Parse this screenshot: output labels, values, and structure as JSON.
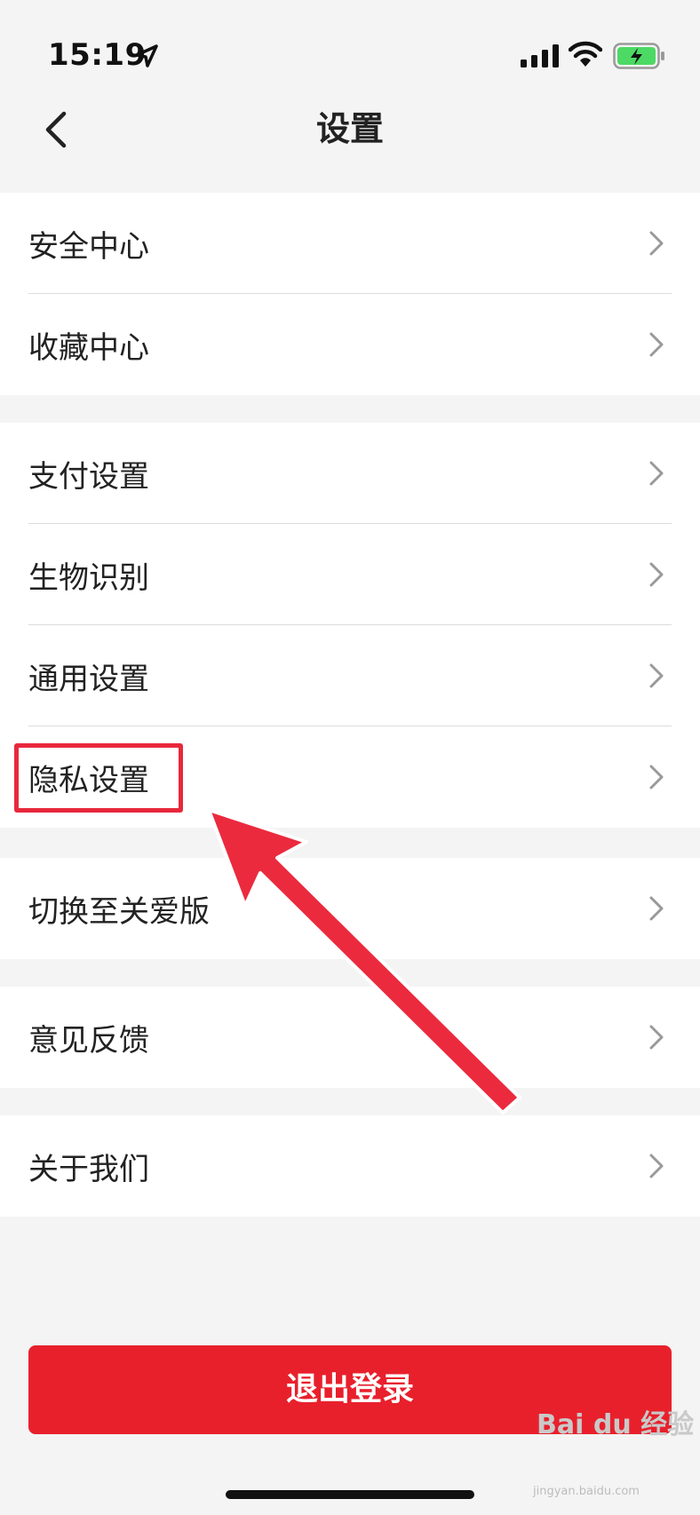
{
  "status_bar": {
    "time": "15:19",
    "icons": [
      "location-arrow-icon",
      "cellular-signal-icon",
      "wifi-icon",
      "battery-charging-icon"
    ]
  },
  "nav": {
    "title": "设置",
    "back_icon": "chevron-left-icon"
  },
  "settings_groups": [
    {
      "items": [
        {
          "label": "安全中心"
        },
        {
          "label": "收藏中心"
        }
      ]
    },
    {
      "items": [
        {
          "label": "支付设置"
        },
        {
          "label": "生物识别"
        },
        {
          "label": "通用设置"
        },
        {
          "label": "隐私设置"
        }
      ]
    },
    {
      "items": [
        {
          "label": "切换至关爱版"
        }
      ]
    },
    {
      "items": [
        {
          "label": "意见反馈"
        }
      ]
    },
    {
      "items": [
        {
          "label": "关于我们"
        }
      ]
    }
  ],
  "logout_label": "退出登录",
  "annotation": {
    "highlighted_item": "隐私设置",
    "color": "#e8283c"
  },
  "watermark": {
    "text": "Bai du 经验",
    "sub": "jingyan.baidu.com"
  },
  "colors": {
    "accent": "#e8202c",
    "background": "#f4f4f4",
    "battery": "#4cd964"
  }
}
